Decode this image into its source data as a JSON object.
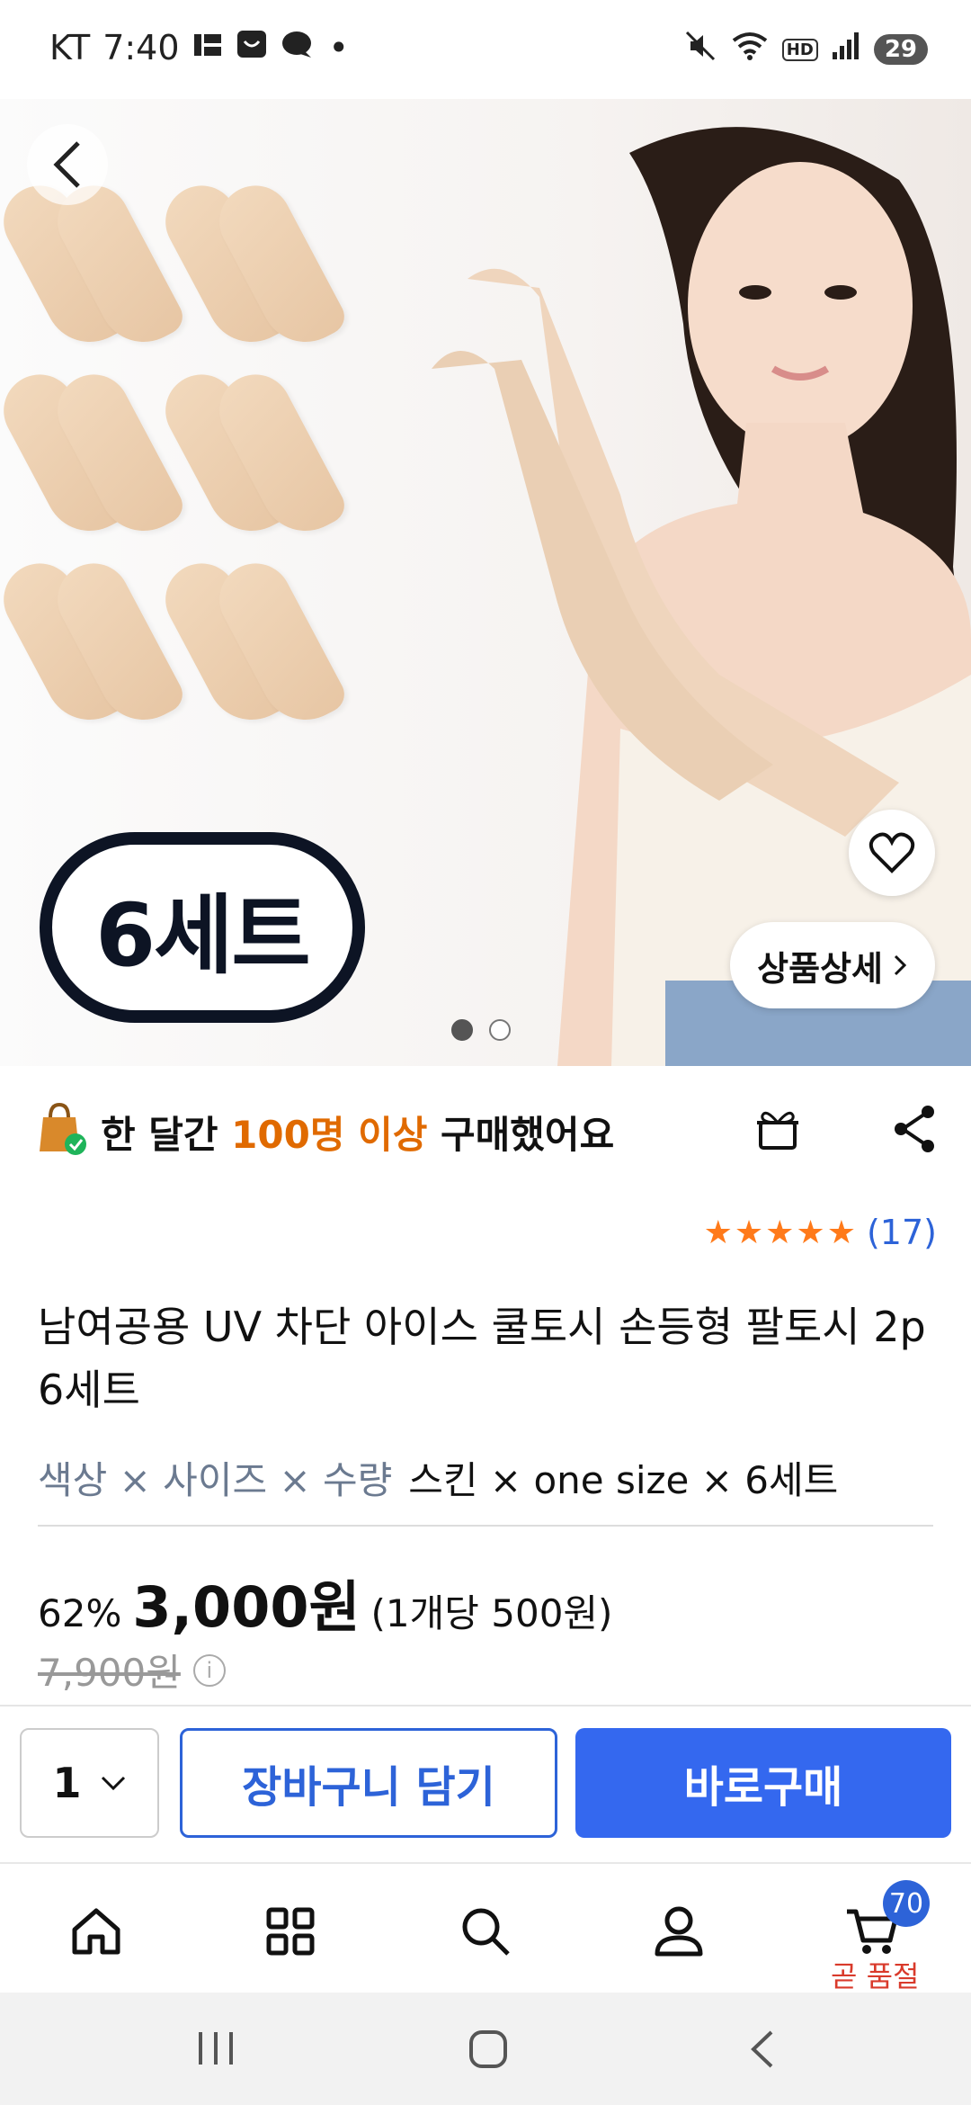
{
  "status_bar": {
    "carrier": "KT",
    "time": "7:40",
    "battery": "29",
    "hd": "HD",
    "wifi_sub": "5"
  },
  "hero": {
    "badge_text": "6세트",
    "detail_button": "상품상세",
    "page_indicator": {
      "current": 1,
      "total": 2
    }
  },
  "stats": {
    "prefix": "한 달간",
    "highlight": "100명 이상",
    "suffix": "구매했어요"
  },
  "rating": {
    "stars": 5,
    "count": "(17)"
  },
  "product": {
    "title": "남여공용 UV 차단 아이스 쿨토시 손등형 팔토시 2p 6세트",
    "option_label": "색상 × 사이즈 × 수량",
    "option_value": "스킨 × one size × 6세트"
  },
  "price": {
    "discount": "62%",
    "sale_price": "3,000원",
    "unit_price": "(1개당 500원)",
    "original_price": "7,900원"
  },
  "actions": {
    "quantity": "1",
    "cart_label": "장바구니 담기",
    "buy_label": "바로구매"
  },
  "bottom_nav": {
    "cart_count": "70",
    "soldout_label": "곧 품절"
  },
  "colors": {
    "accent_blue": "#3468ef",
    "highlight_orange": "#e06a00",
    "star_orange": "#ff7a1a",
    "soldout_red": "#d93a2b"
  }
}
